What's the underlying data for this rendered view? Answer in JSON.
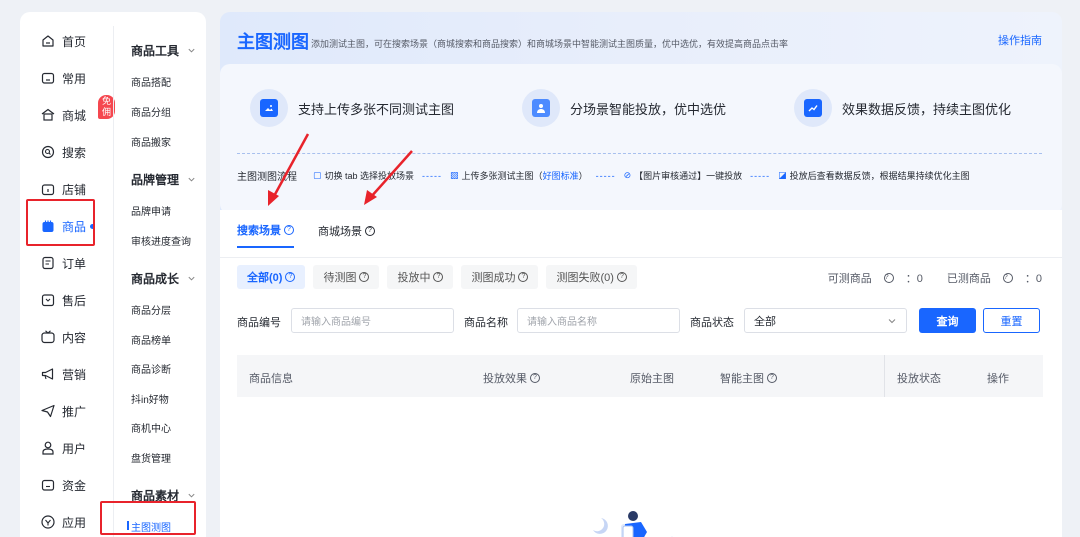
{
  "nav": {
    "items": [
      {
        "label": "首页",
        "icon": "home-icon"
      },
      {
        "label": "常用",
        "icon": "folder-icon"
      },
      {
        "label": "商城",
        "icon": "store-icon",
        "badge": "免佣"
      },
      {
        "label": "搜索",
        "icon": "search-icon"
      },
      {
        "label": "店铺",
        "icon": "shop-icon"
      },
      {
        "label": "商品",
        "icon": "goods-bag-icon",
        "active": true
      },
      {
        "label": "订单",
        "icon": "order-icon"
      },
      {
        "label": "售后",
        "icon": "after-sales-icon"
      },
      {
        "label": "内容",
        "icon": "tv-icon"
      },
      {
        "label": "营销",
        "icon": "megaphone-icon"
      },
      {
        "label": "推广",
        "icon": "send-icon"
      },
      {
        "label": "用户",
        "icon": "user-icon"
      },
      {
        "label": "资金",
        "icon": "wallet-icon"
      },
      {
        "label": "应用",
        "icon": "app-icon"
      }
    ]
  },
  "subnav": {
    "groups": [
      {
        "title": "商品工具",
        "items": [
          "商品搭配",
          "商品分组",
          "商品搬家"
        ]
      },
      {
        "title": "品牌管理",
        "items": [
          "品牌申请",
          "审核进度查询"
        ]
      },
      {
        "title": "商品成长",
        "items": [
          "商品分层",
          "商品榜单",
          "商品诊断",
          "抖in好物",
          "商机中心",
          "盘货管理"
        ]
      },
      {
        "title": "商品素材",
        "items": [
          "主图测图"
        ]
      }
    ]
  },
  "header": {
    "title": "主图测图",
    "description": "添加测试主图，可在搜索场景（商城搜索和商品搜索）和商城场景中智能测试主图质量，优中选优，有效提高商品点击率",
    "guide_link": "操作指南"
  },
  "features": [
    {
      "label": "支持上传多张不同测试主图",
      "icon": "image-icon"
    },
    {
      "label": "分场景智能投放，优中选优",
      "icon": "person-icon"
    },
    {
      "label": "效果数据反馈，持续主图优化",
      "icon": "trend-chart-icon"
    }
  ],
  "flow": {
    "title": "主图测图流程",
    "steps": [
      {
        "text": "切换 tab 选择投放场景",
        "icon": "tab-icon"
      },
      {
        "text_before": "上传多张测试主图（",
        "link": "好图标准",
        "text_after": "）",
        "icon": "upload-icon"
      },
      {
        "text": "【图片审核通过】一键投放",
        "icon": "check-icon"
      },
      {
        "text": "投放后查看数据反馈，根据结果持续优化主图",
        "icon": "feedback-icon"
      }
    ],
    "separator": "-----"
  },
  "tabs": [
    {
      "label": "搜索场景",
      "active": true
    },
    {
      "label": "商城场景",
      "active": false
    }
  ],
  "chips": [
    {
      "label": "全部(0)",
      "active": true
    },
    {
      "label": "待测图",
      "active": false
    },
    {
      "label": "投放中",
      "active": false
    },
    {
      "label": "测图成功",
      "active": false
    },
    {
      "label": "测图失败(0)",
      "active": false
    }
  ],
  "counts": {
    "testable_label": "可测商品",
    "testable_value": "：0",
    "tested_label": "已测商品",
    "tested_value": "：0"
  },
  "filters": {
    "id_label": "商品编号",
    "id_placeholder": "请输入商品编号",
    "name_label": "商品名称",
    "name_placeholder": "请输入商品名称",
    "status_label": "商品状态",
    "status_value": "全部",
    "query_button": "查询",
    "reset_button": "重置"
  },
  "table": {
    "columns": [
      "商品信息",
      "投放效果",
      "原始主图",
      "智能主图",
      "投放状态",
      "操作"
    ]
  },
  "colors": {
    "accent": "#1966ff",
    "highlight_red": "#e8232b",
    "badge_red": "#f5474f"
  }
}
